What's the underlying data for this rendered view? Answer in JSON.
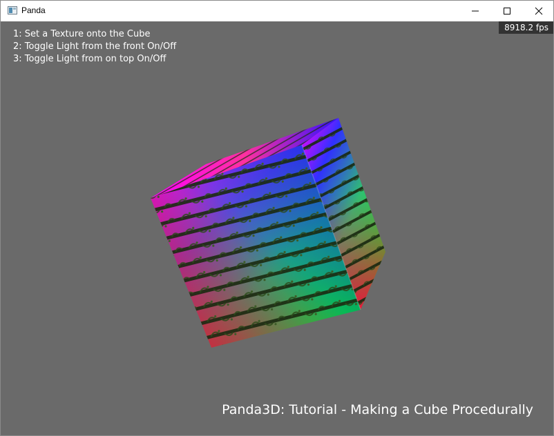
{
  "window": {
    "title": "Panda",
    "icon": "panda-app-icon",
    "controls": [
      "minimize-icon",
      "maximize-icon",
      "close-icon"
    ]
  },
  "overlay": {
    "fps": "8918.2 fps",
    "help_lines": [
      "1: Set a Texture onto the Cube",
      "2: Toggle Light from the front On/Off",
      "3: Toggle Light from on top On/Off"
    ],
    "title": "Panda3D: Tutorial - Making a Cube Procedurally"
  },
  "scene": {
    "background": "#6a6a6a",
    "object": "textured-cube",
    "vertex_colors": [
      "#ff00ff",
      "#0000ff",
      "#00ff00",
      "#ff0000"
    ]
  }
}
